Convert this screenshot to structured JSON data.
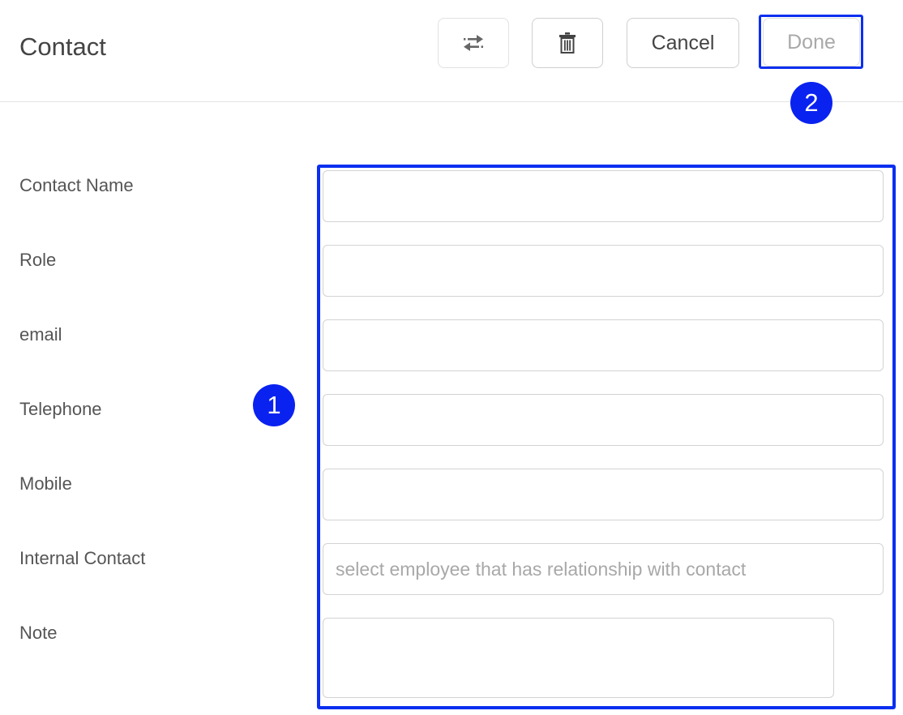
{
  "header": {
    "title": "Contact",
    "buttons": {
      "switch_icon": "swap-arrows-icon",
      "delete_icon": "trash-icon",
      "cancel_label": "Cancel",
      "done_label": "Done"
    }
  },
  "annotations": {
    "badge_1": "1",
    "badge_2": "2",
    "highlight_color": "#0a2ff0"
  },
  "form": {
    "fields": [
      {
        "label": "Contact Name",
        "value": "",
        "placeholder": ""
      },
      {
        "label": "Role",
        "value": "",
        "placeholder": ""
      },
      {
        "label": "email",
        "value": "",
        "placeholder": ""
      },
      {
        "label": "Telephone",
        "value": "",
        "placeholder": ""
      },
      {
        "label": "Mobile",
        "value": "",
        "placeholder": ""
      },
      {
        "label": "Internal Contact",
        "value": "",
        "placeholder": "select employee that has relationship with contact"
      },
      {
        "label": "Note",
        "value": "",
        "placeholder": ""
      }
    ]
  }
}
